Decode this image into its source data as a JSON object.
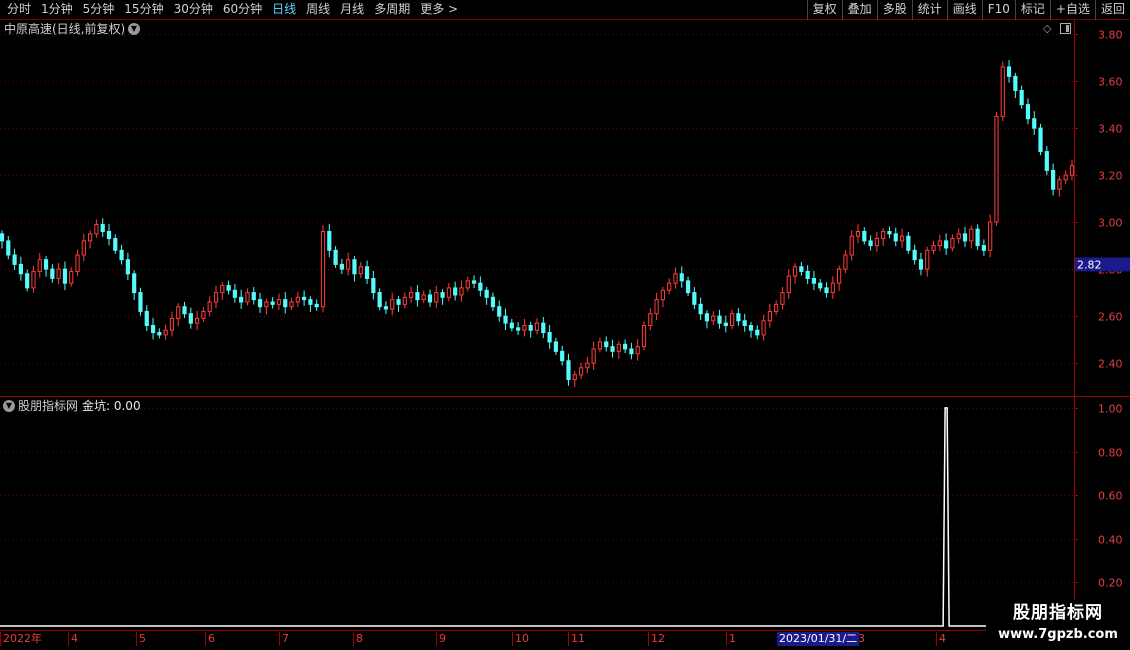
{
  "toolbar": {
    "periods": [
      {
        "label": "分时"
      },
      {
        "label": "1分钟"
      },
      {
        "label": "5分钟"
      },
      {
        "label": "15分钟"
      },
      {
        "label": "30分钟"
      },
      {
        "label": "60分钟"
      },
      {
        "label": "日线",
        "active": true
      },
      {
        "label": "周线"
      },
      {
        "label": "月线"
      },
      {
        "label": "多周期"
      },
      {
        "label": "更多 >"
      }
    ],
    "actions": [
      {
        "label": "复权"
      },
      {
        "label": "叠加"
      },
      {
        "label": "多股"
      },
      {
        "label": "统计"
      },
      {
        "label": "画线"
      },
      {
        "label": "F10"
      },
      {
        "label": "标记"
      },
      {
        "label": "+自选"
      },
      {
        "label": "返回"
      }
    ]
  },
  "main_chart": {
    "title": "中原高速(日线,前复权)",
    "dropdown_icon": "chevron-down-icon",
    "price_axis": [
      "3.80",
      "3.60",
      "3.40",
      "3.20",
      "3.00",
      "2.80",
      "2.60",
      "2.40"
    ],
    "current_price": "2.82"
  },
  "sub_chart": {
    "title": "股朋指标网",
    "indicator_label": "金坑: 0.00",
    "axis": [
      "1.00",
      "0.80",
      "0.60",
      "0.40",
      "0.20"
    ]
  },
  "date_axis": {
    "labels": [
      "2022年",
      "4",
      "5",
      "6",
      "7",
      "8",
      "9",
      "10",
      "11",
      "12",
      "1",
      "2023/01/31/二",
      "3",
      "4"
    ],
    "cursor_label": "2023/01/31/二"
  },
  "watermark": {
    "title": "股朋指标网",
    "url": "www.7gpzb.com"
  },
  "colors": {
    "up": "#ff3c3c",
    "down": "#54fcfc",
    "grid": "#7a0000",
    "axis_text": "#e04040",
    "signal": "#ffffff"
  },
  "chart_data": [
    {
      "type": "candlestick",
      "title": "中原高速(日线,前复权)",
      "y_ticks": [
        2.4,
        2.6,
        2.8,
        3.0,
        3.2,
        3.4,
        3.6,
        3.8
      ],
      "ylim": [
        2.26,
        3.86
      ],
      "x_tick_labels": [
        "2022年",
        "4",
        "5",
        "6",
        "7",
        "8",
        "9",
        "10",
        "11",
        "12",
        "1",
        "2",
        "3",
        "4"
      ],
      "last_price": 2.82,
      "close_series": [
        2.92,
        2.86,
        2.82,
        2.78,
        2.72,
        2.79,
        2.84,
        2.8,
        2.76,
        2.8,
        2.74,
        2.79,
        2.86,
        2.92,
        2.95,
        2.99,
        2.96,
        2.93,
        2.88,
        2.84,
        2.78,
        2.7,
        2.62,
        2.56,
        2.53,
        2.52,
        2.54,
        2.59,
        2.64,
        2.61,
        2.57,
        2.59,
        2.62,
        2.66,
        2.7,
        2.73,
        2.71,
        2.68,
        2.66,
        2.7,
        2.67,
        2.64,
        2.66,
        2.65,
        2.67,
        2.64,
        2.66,
        2.68,
        2.67,
        2.65,
        2.64,
        2.96,
        2.88,
        2.82,
        2.8,
        2.84,
        2.78,
        2.81,
        2.76,
        2.7,
        2.64,
        2.63,
        2.67,
        2.65,
        2.68,
        2.7,
        2.67,
        2.69,
        2.66,
        2.7,
        2.68,
        2.72,
        2.69,
        2.72,
        2.75,
        2.74,
        2.71,
        2.68,
        2.64,
        2.6,
        2.57,
        2.55,
        2.54,
        2.56,
        2.54,
        2.57,
        2.53,
        2.49,
        2.45,
        2.41,
        2.33,
        2.35,
        2.38,
        2.4,
        2.46,
        2.49,
        2.47,
        2.45,
        2.48,
        2.46,
        2.44,
        2.47,
        2.56,
        2.61,
        2.67,
        2.71,
        2.74,
        2.78,
        2.75,
        2.7,
        2.65,
        2.61,
        2.58,
        2.6,
        2.57,
        2.56,
        2.61,
        2.58,
        2.56,
        2.54,
        2.52,
        2.58,
        2.62,
        2.65,
        2.7,
        2.77,
        2.81,
        2.79,
        2.76,
        2.74,
        2.72,
        2.7,
        2.74,
        2.8,
        2.86,
        2.94,
        2.96,
        2.92,
        2.9,
        2.93,
        2.96,
        2.95,
        2.92,
        2.94,
        2.88,
        2.84,
        2.8,
        2.88,
        2.9,
        2.92,
        2.89,
        2.93,
        2.95,
        2.92,
        2.97,
        2.9,
        2.88,
        3.0,
        3.45,
        3.66,
        3.62,
        3.56,
        3.5,
        3.44,
        3.4,
        3.3,
        3.22,
        3.14,
        3.18,
        3.2,
        3.24
      ]
    },
    {
      "type": "line",
      "title": "股朋指标网",
      "series": [
        {
          "name": "金坑",
          "signal_index": 150,
          "signal_value": 1.0,
          "baseline": 0.0
        }
      ],
      "y_ticks": [
        0.2,
        0.4,
        0.6,
        0.8,
        1.0
      ],
      "ylim": [
        0,
        1.05
      ]
    }
  ]
}
